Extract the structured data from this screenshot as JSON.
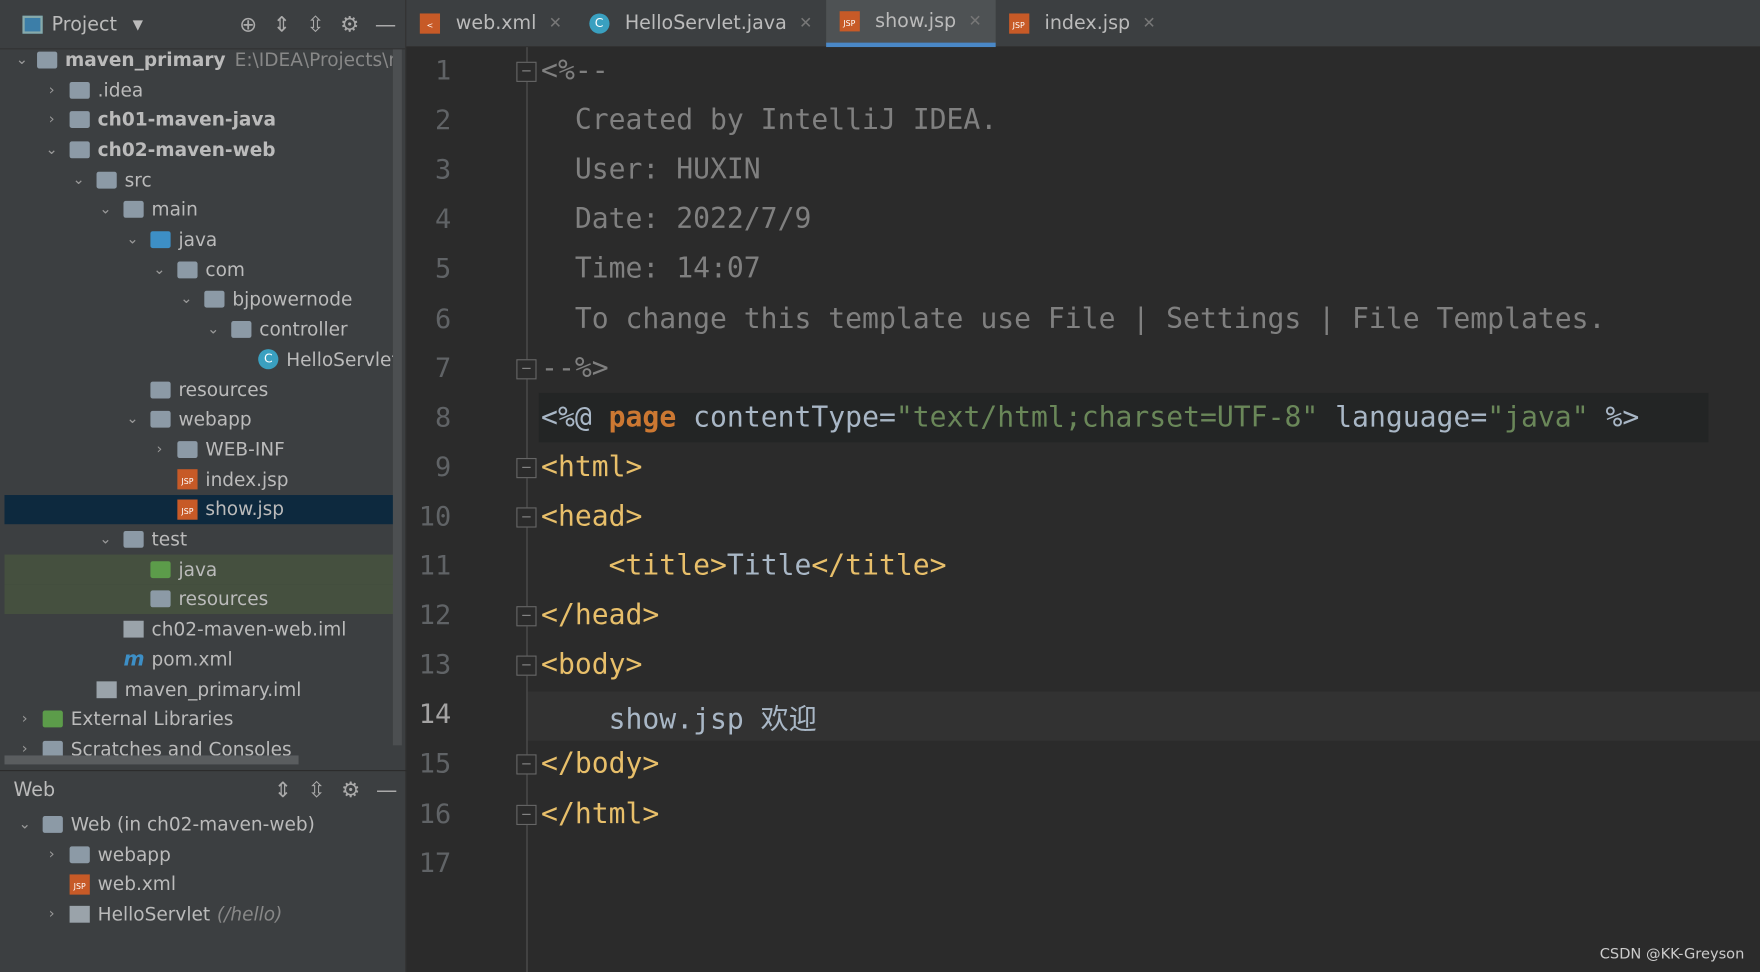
{
  "project_panel": {
    "title": "Project",
    "icons": [
      "locate-icon",
      "expand-all-icon",
      "collapse-all-icon",
      "gear-icon",
      "minimize-icon"
    ]
  },
  "tree": [
    {
      "label": "maven_primary",
      "extra": "E:\\IDEA\\Projects\\maven_primary",
      "depth": 0,
      "chev": "down",
      "icon": "module",
      "bold": true
    },
    {
      "label": ".idea",
      "depth": 1,
      "chev": "right",
      "icon": "folder"
    },
    {
      "label": "ch01-maven-java",
      "depth": 1,
      "chev": "right",
      "icon": "module",
      "bold": true
    },
    {
      "label": "ch02-maven-web",
      "depth": 1,
      "chev": "down",
      "icon": "module",
      "bold": true
    },
    {
      "label": "src",
      "depth": 2,
      "chev": "down",
      "icon": "folder"
    },
    {
      "label": "main",
      "depth": 3,
      "chev": "down",
      "icon": "folder"
    },
    {
      "label": "java",
      "depth": 4,
      "chev": "down",
      "icon": "folder-blue"
    },
    {
      "label": "com",
      "depth": 5,
      "chev": "down",
      "icon": "folder"
    },
    {
      "label": "bjpowernode",
      "depth": 6,
      "chev": "down",
      "icon": "folder"
    },
    {
      "label": "controller",
      "depth": 7,
      "chev": "down",
      "icon": "folder"
    },
    {
      "label": "HelloServlet",
      "depth": 8,
      "chev": "",
      "icon": "class"
    },
    {
      "label": "resources",
      "depth": 4,
      "chev": "",
      "icon": "folder"
    },
    {
      "label": "webapp",
      "depth": 4,
      "chev": "down",
      "icon": "folder"
    },
    {
      "label": "WEB-INF",
      "depth": 5,
      "chev": "right",
      "icon": "folder"
    },
    {
      "label": "index.jsp",
      "depth": 5,
      "chev": "",
      "icon": "jsp"
    },
    {
      "label": "show.jsp",
      "depth": 5,
      "chev": "",
      "icon": "jsp",
      "selected": true
    },
    {
      "label": "test",
      "depth": 3,
      "chev": "down",
      "icon": "folder"
    },
    {
      "label": "java",
      "depth": 4,
      "chev": "",
      "icon": "folder-green",
      "test": true
    },
    {
      "label": "resources",
      "depth": 4,
      "chev": "",
      "icon": "folder",
      "test": true
    },
    {
      "label": "ch02-maven-web.iml",
      "depth": 3,
      "chev": "",
      "icon": "file"
    },
    {
      "label": "pom.xml",
      "depth": 3,
      "chev": "",
      "icon": "maven"
    },
    {
      "label": "maven_primary.iml",
      "depth": 2,
      "chev": "",
      "icon": "file"
    },
    {
      "label": "External Libraries",
      "depth": 0,
      "chev": "right",
      "icon": "library"
    },
    {
      "label": "Scratches and Consoles",
      "depth": 0,
      "chev": "right",
      "icon": "scratch"
    }
  ],
  "web_panel": {
    "title": "Web",
    "items": [
      {
        "label": "Web (in ch02-maven-web)",
        "depth": 0,
        "chev": "down",
        "icon": "module"
      },
      {
        "label": "webapp",
        "depth": 1,
        "chev": "right",
        "icon": "folder"
      },
      {
        "label": "web.xml",
        "depth": 1,
        "chev": "",
        "icon": "jsp"
      },
      {
        "label": "HelloServlet",
        "extra": "(/hello)",
        "depth": 1,
        "chev": "right",
        "icon": "file"
      }
    ]
  },
  "tabs": [
    {
      "label": "web.xml",
      "icon": "xml"
    },
    {
      "label": "HelloServlet.java",
      "icon": "class"
    },
    {
      "label": "show.jsp",
      "icon": "jsp",
      "active": true
    },
    {
      "label": "index.jsp",
      "icon": "jsp"
    }
  ],
  "editor": {
    "current_line": 14,
    "lines": [
      [
        [
          "cm",
          "<%--"
        ]
      ],
      [
        [
          "cm",
          "  Created by IntelliJ IDEA."
        ]
      ],
      [
        [
          "cm",
          "  User: HUXIN"
        ]
      ],
      [
        [
          "cm",
          "  Date: 2022/7/9"
        ]
      ],
      [
        [
          "cm",
          "  Time: 14:07"
        ]
      ],
      [
        [
          "cm",
          "  To change this template use File | Settings | File Templates."
        ]
      ],
      [
        [
          "cm",
          "--%>"
        ]
      ],
      [
        [
          "tx",
          "<%@ "
        ],
        [
          "kw",
          "page"
        ],
        [
          "tx",
          " contentType="
        ],
        [
          "st",
          "\"text/html;charset=UTF-8\""
        ],
        [
          "tx",
          " language="
        ],
        [
          "st",
          "\"java\""
        ],
        [
          "tx",
          " %>"
        ]
      ],
      [
        [
          "tg",
          "<html>"
        ]
      ],
      [
        [
          "tg",
          "<head>"
        ]
      ],
      [
        [
          "tg",
          "    <title>"
        ],
        [
          "tx",
          "Title"
        ],
        [
          "tg",
          "</title>"
        ]
      ],
      [
        [
          "tg",
          "</head>"
        ]
      ],
      [
        [
          "tg",
          "<body>"
        ]
      ],
      [
        [
          "tx",
          "    show.jsp 欢迎"
        ]
      ],
      [
        [
          "tg",
          "</body>"
        ]
      ],
      [
        [
          "tg",
          "</html>"
        ]
      ],
      []
    ]
  },
  "watermark": "CSDN @KK-Greyson"
}
